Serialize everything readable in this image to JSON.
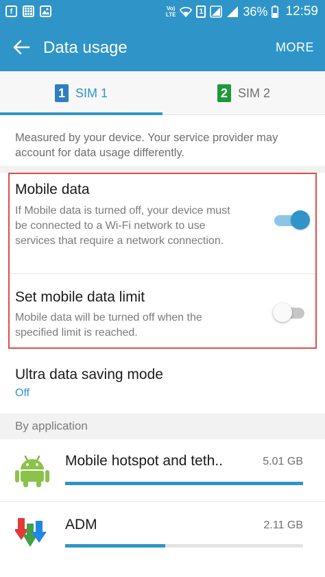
{
  "status_bar": {
    "lte_top": "Vo)",
    "lte_bottom": "LTE",
    "sim_number": "1",
    "battery_percent": "36%",
    "time": "12:59"
  },
  "app_bar": {
    "title": "Data usage",
    "more_label": "MORE"
  },
  "tabs": [
    {
      "badge": "1",
      "label": "SIM 1",
      "selected": true,
      "color": "#2f7fc0"
    },
    {
      "badge": "2",
      "label": "SIM 2",
      "selected": false,
      "color": "#1e9a3c"
    }
  ],
  "notice": "Measured by your device. Your service provider may account for data usage differently.",
  "settings": {
    "mobile_data": {
      "title": "Mobile data",
      "description": "If Mobile data is turned off, your device must be connected to a Wi-Fi network to use services that require a network connection.",
      "enabled": true
    },
    "data_limit": {
      "title": "Set mobile data limit",
      "description": "Mobile data will be turned off when the specified limit is reached.",
      "enabled": false
    },
    "ultra_saving": {
      "title": "Ultra data saving mode",
      "status": "Off"
    }
  },
  "section_header": "By application",
  "apps": [
    {
      "name": "Mobile hotspot and teth..",
      "size": "5.01 GB",
      "usage_fraction": 1.0,
      "icon": "android-icon"
    },
    {
      "name": "ADM",
      "size": "2.11 GB",
      "usage_fraction": 0.42,
      "icon": "adm-download-icon"
    }
  ],
  "colors": {
    "accent": "#2f95c8",
    "highlight_border": "#e24a4a"
  }
}
